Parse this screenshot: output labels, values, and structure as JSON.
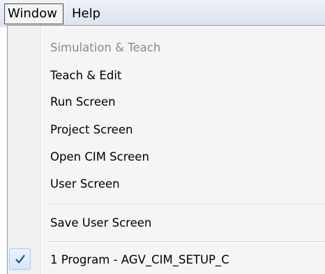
{
  "menubar": {
    "items": [
      {
        "label": "Window",
        "active": true
      },
      {
        "label": "Help",
        "active": false
      }
    ]
  },
  "dropdown": {
    "items": [
      {
        "label": "Simulation & Teach",
        "enabled": false
      },
      {
        "label": "Teach & Edit",
        "enabled": true
      },
      {
        "label": "Run Screen",
        "enabled": true
      },
      {
        "label": "Project Screen",
        "enabled": true
      },
      {
        "label": "Open CIM Screen",
        "enabled": true
      },
      {
        "label": "User Screen",
        "enabled": true
      },
      {
        "label": "Save User Screen",
        "enabled": true
      },
      {
        "label": "1 Program -  AGV_CIM_SETUP_C",
        "enabled": true,
        "checked": true
      }
    ]
  },
  "colors": {
    "check_mark": "#1c4fa0",
    "menu_background": "#f5f5f5",
    "disabled_text": "#8a8a8a"
  },
  "icons": {
    "check": "checkmark-icon"
  }
}
